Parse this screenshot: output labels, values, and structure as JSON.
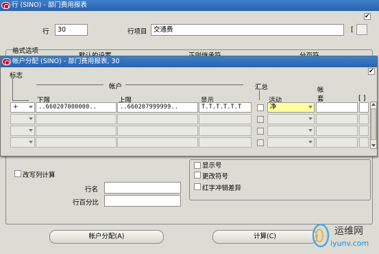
{
  "main_window": {
    "title": "行 (SINO) - 部门费用报表",
    "row_label": "行",
    "row_value": "30",
    "row_item_label": "行项目",
    "row_item_value": "交通费",
    "bracket_label": "[",
    "format_options_label": "格式选项",
    "hidden_tab_1": "默认的设置",
    "hidden_tab_2": "正则继承符",
    "hidden_tab_3": "分页符",
    "rewrite_calc_label": "改写列计算",
    "row_name_label": "行名",
    "row_name_value": "",
    "row_percent_label": "行百分比",
    "row_percent_value": "",
    "show_label": "显示号",
    "change_sign_label": "更改符号",
    "red_reverse_label": "红字冲销差异",
    "account_assign_button": "帐户分配(A)",
    "calc_button": "计算(C)"
  },
  "dialog": {
    "title": "帐户分配 (SINO) - 部门费用报表, 30",
    "flag_label": "标志",
    "account_group_label": "帐户",
    "low_label": "下限",
    "high_label": "上限",
    "display_label": "显示",
    "summary_label": "汇总",
    "activity_label": "活动",
    "set_label_1": "帐",
    "set_label_2": "套",
    "bracket_col_label": "[ ]",
    "rows": [
      {
        "sign": "+",
        "low": "..660207000000..",
        "high": "..660207999999..",
        "display": "T.T.T.T.T.T",
        "activity": "净",
        "set": ""
      },
      {
        "sign": "",
        "low": "",
        "high": "",
        "display": "",
        "activity": "",
        "set": ""
      },
      {
        "sign": "",
        "low": "",
        "high": "",
        "display": "",
        "activity": "",
        "set": ""
      },
      {
        "sign": "",
        "low": "",
        "high": "",
        "display": "",
        "activity": "",
        "set": ""
      }
    ]
  },
  "watermark": {
    "brand": "运维网",
    "url": "iyunv.com"
  },
  "colors": {
    "titlebar": "#2f6db8",
    "highlight": "#ffff9e",
    "window_bg": "#dcdcd4"
  }
}
